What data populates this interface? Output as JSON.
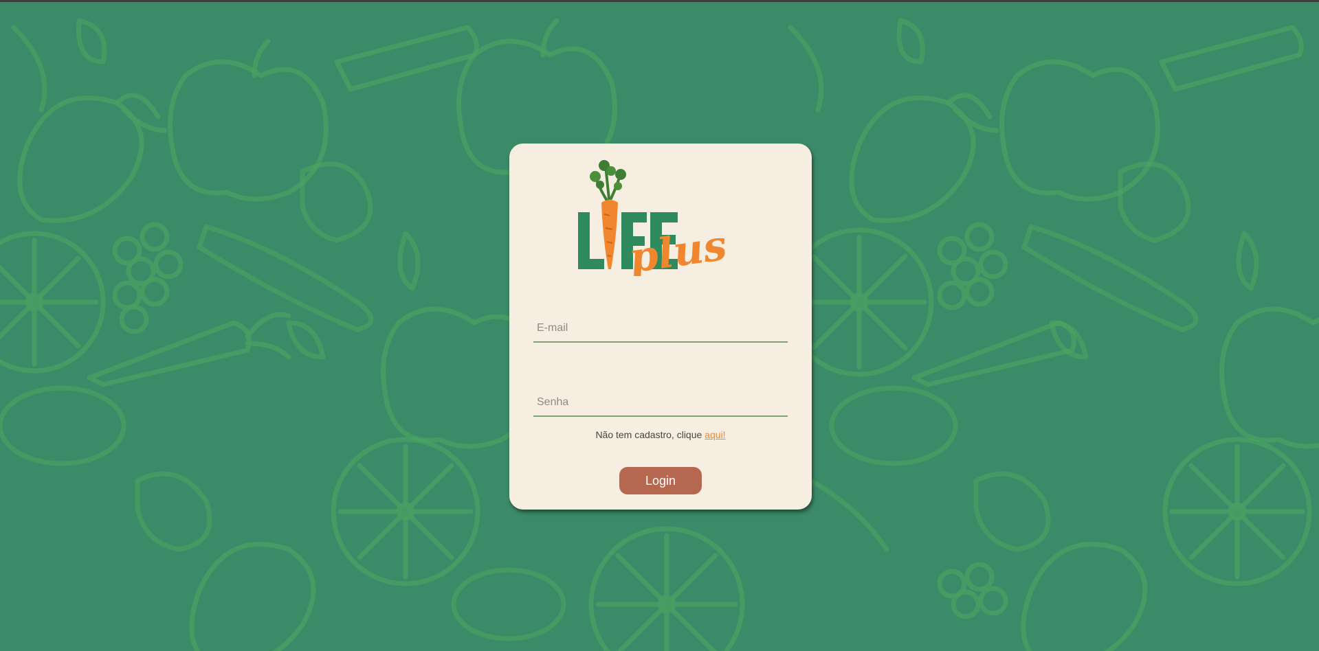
{
  "brand": {
    "logo_text_primary": "LIFE",
    "logo_text_secondary": "plus",
    "icon": "carrot-icon",
    "colors": {
      "primary_green": "#2f8a5e",
      "accent_orange": "#f0872f",
      "background_green": "#3b8b68",
      "pattern_green": "#4ba760",
      "card_background": "#f7eee2",
      "button_color": "#b5684f"
    }
  },
  "login_form": {
    "email_placeholder": "E-mail",
    "email_value": "",
    "password_placeholder": "Senha",
    "password_value": "",
    "signup_prompt": "Não tem cadastro, clique ",
    "signup_link_label": "aqui!",
    "login_button_label": "Login"
  }
}
